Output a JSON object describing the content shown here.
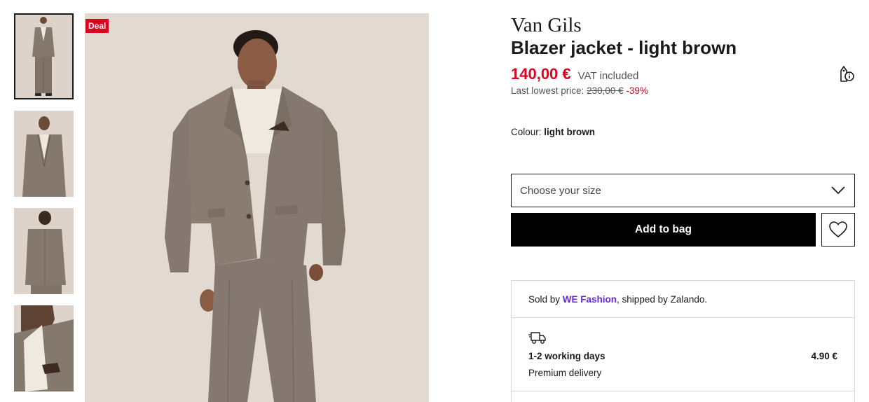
{
  "gallery": {
    "badge": "Deal",
    "thumbnails": [
      "front-full",
      "front-mid",
      "back",
      "detail"
    ]
  },
  "product": {
    "brand": "Van Gils",
    "title": "Blazer jacket - light brown",
    "price": "140,00 €",
    "vat_note": "VAT included",
    "lowest_label": "Last lowest price:",
    "lowest_price": "230,00 €",
    "discount": "-39%",
    "colour_label": "Colour:",
    "colour_value": "light brown",
    "price_color": "#d9041e"
  },
  "actions": {
    "size_placeholder": "Choose your size",
    "add_to_bag": "Add to bag"
  },
  "info": {
    "sold_by_prefix": "Sold by",
    "seller": "WE Fashion",
    "shipped_by": ", shipped by Zalando.",
    "delivery_time": "1-2 working days",
    "delivery_price": "4.90 €",
    "delivery_type": "Premium delivery"
  },
  "icons": [
    "price-tag-info-icon",
    "chevron-down-icon",
    "heart-icon",
    "truck-icon"
  ]
}
